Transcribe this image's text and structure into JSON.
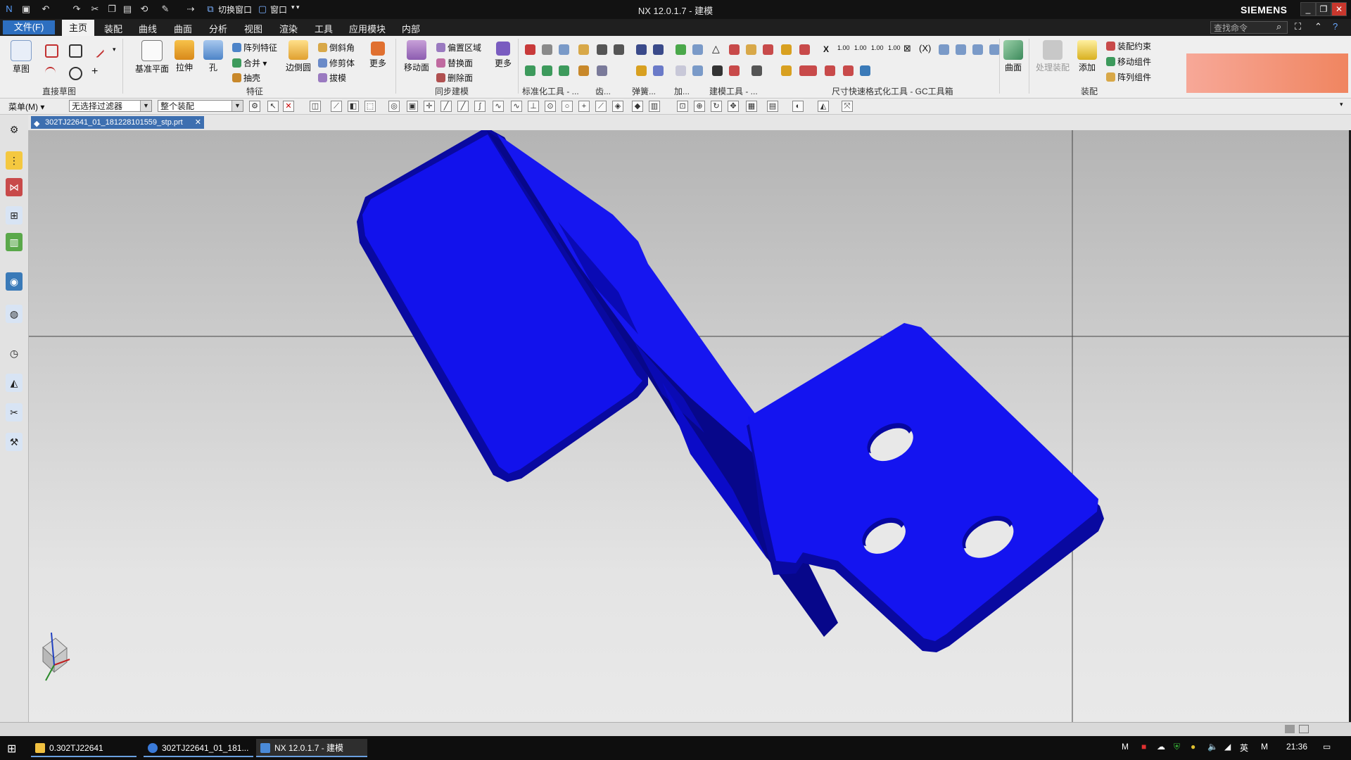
{
  "titlebar": {
    "title": "NX 12.0.1.7 - 建模",
    "brand": "SIEMENS",
    "switch_window": "切换窗口",
    "window_menu": "窗口"
  },
  "menubar": {
    "file": "文件(F)",
    "tabs": [
      "主页",
      "装配",
      "曲线",
      "曲面",
      "分析",
      "视图",
      "渲染",
      "工具",
      "应用模块",
      "内部"
    ],
    "search_placeholder": "查找命令"
  },
  "ribbon": {
    "sketch": "草图",
    "direct_sketch_group": "直接草图",
    "datum_plane": "基准平面",
    "extrude": "拉伸",
    "hole": "孔",
    "pattern_feature": "阵列特征",
    "unite": "合并",
    "shell": "抽壳",
    "edge_blend": "边倒圆",
    "chamfer": "倒斜角",
    "trim_body": "修剪体",
    "draft": "拔模",
    "more": "更多",
    "feature_group": "特征",
    "move_face": "移动面",
    "offset_region": "偏置区域",
    "replace_face": "替换面",
    "delete_face": "删除面",
    "sync_more": "更多",
    "sync_group": "同步建模",
    "standard_tools": "标准化工具 - ...",
    "gear": "齿...",
    "spring": "弹簧...",
    "add": "加...",
    "modeling_tools": "建模工具 - ...",
    "dim_tools": "尺寸快速格式化工具 - GC工具箱",
    "surface": "曲面",
    "process_assembly": "处理装配",
    "add_component": "添加",
    "assembly_constraint": "装配约束",
    "move_component": "移动组件",
    "pattern_component": "阵列组件",
    "assembly_group": "装配",
    "dim_labels": [
      "1.00",
      "1.00",
      "1.00",
      "1.00"
    ]
  },
  "selection_bar": {
    "menu": "菜单(M)",
    "filter": "无选择过滤器",
    "scope": "整个装配"
  },
  "document_tab": {
    "name": "302TJ22641_01_181228101559_stp.prt"
  },
  "taskbar": {
    "items": [
      "0.302TJ22641",
      "302TJ22641_01_181...",
      "NX 12.0.1.7 - 建模"
    ],
    "language": "英",
    "time": "21:36"
  },
  "colors": {
    "part_blue": "#1010e6",
    "part_dark": "#0a0aa8",
    "file_menu_blue": "#2d6fc0",
    "promo_gradient_start": "#f7a898",
    "promo_gradient_end": "#f08560"
  }
}
